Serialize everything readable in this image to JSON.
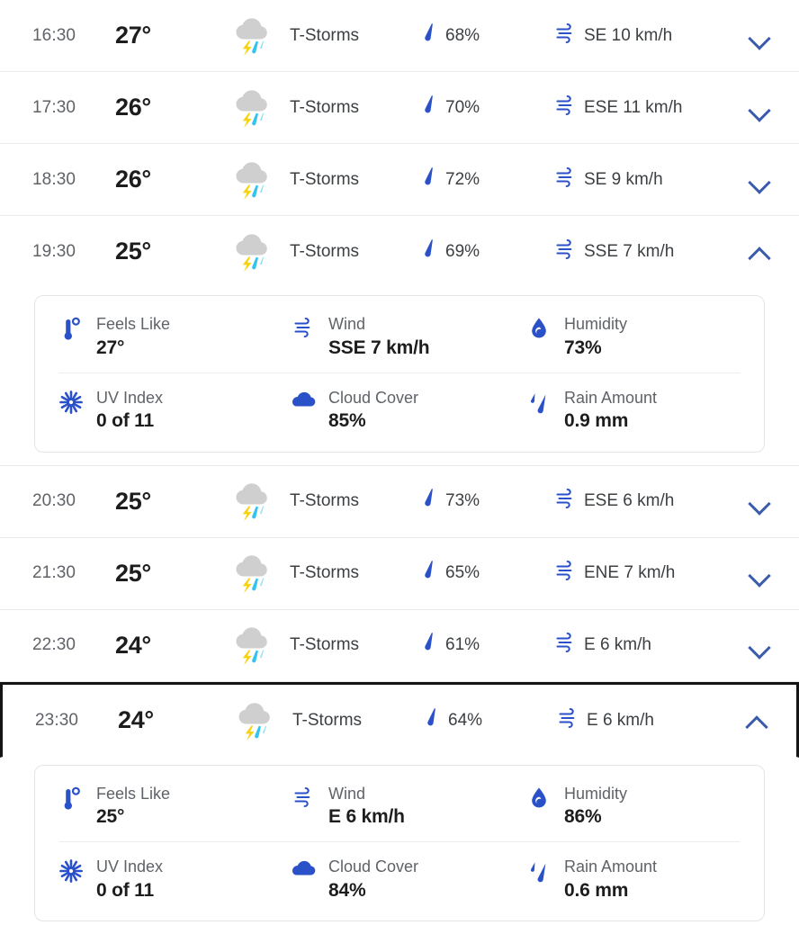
{
  "colors": {
    "accent_blue": "#3b5bab",
    "icon_blue": "#2b51c8",
    "time_gray": "#5f6368",
    "temp_black": "#1d1d1d",
    "cloud_gray": "#cfcfcf",
    "bolt_yellow": "#f5d313",
    "rain_cyan": "#35c3f0",
    "focus_border": "#141414",
    "row_divider": "#ebebeb"
  },
  "icons": {
    "storm": "thunderstorm-icon",
    "precip": "raindrop-icon",
    "wind": "wind-icon",
    "chevron_down": "chevron-down-icon",
    "chevron_up": "chevron-up-icon",
    "feels_like": "thermometer-icon",
    "wind_detail": "wind-icon",
    "humidity": "water-drop-icon",
    "uv_index": "sun-icon",
    "cloud_cover": "cloud-icon",
    "rain_amount": "rain-drops-icon"
  },
  "detail_labels": {
    "feels_like": "Feels Like",
    "wind": "Wind",
    "humidity": "Humidity",
    "uv_index": "UV Index",
    "cloud_cover": "Cloud Cover",
    "rain_amount": "Rain Amount"
  },
  "rows": [
    {
      "time": "16:30",
      "temp": "27°",
      "condition": "T-Storms",
      "precip": "68%",
      "wind": "SE 10 km/h",
      "expanded": false,
      "focused": false
    },
    {
      "time": "17:30",
      "temp": "26°",
      "condition": "T-Storms",
      "precip": "70%",
      "wind": "ESE 11 km/h",
      "expanded": false,
      "focused": false
    },
    {
      "time": "18:30",
      "temp": "26°",
      "condition": "T-Storms",
      "precip": "72%",
      "wind": "SE 9 km/h",
      "expanded": false,
      "focused": false
    },
    {
      "time": "19:30",
      "temp": "25°",
      "condition": "T-Storms",
      "precip": "69%",
      "wind": "SSE 7 km/h",
      "expanded": true,
      "focused": false,
      "details": {
        "feels_like": "27°",
        "wind": "SSE 7 km/h",
        "humidity": "73%",
        "uv_index": "0 of 11",
        "cloud_cover": "85%",
        "rain_amount": "0.9 mm"
      }
    },
    {
      "time": "20:30",
      "temp": "25°",
      "condition": "T-Storms",
      "precip": "73%",
      "wind": "ESE 6 km/h",
      "expanded": false,
      "focused": false
    },
    {
      "time": "21:30",
      "temp": "25°",
      "condition": "T-Storms",
      "precip": "65%",
      "wind": "ENE 7 km/h",
      "expanded": false,
      "focused": false
    },
    {
      "time": "22:30",
      "temp": "24°",
      "condition": "T-Storms",
      "precip": "61%",
      "wind": "E 6 km/h",
      "expanded": false,
      "focused": false
    },
    {
      "time": "23:30",
      "temp": "24°",
      "condition": "T-Storms",
      "precip": "64%",
      "wind": "E 6 km/h",
      "expanded": true,
      "focused": true,
      "details": {
        "feels_like": "25°",
        "wind": "E 6 km/h",
        "humidity": "86%",
        "uv_index": "0 of 11",
        "cloud_cover": "84%",
        "rain_amount": "0.6 mm"
      }
    }
  ]
}
